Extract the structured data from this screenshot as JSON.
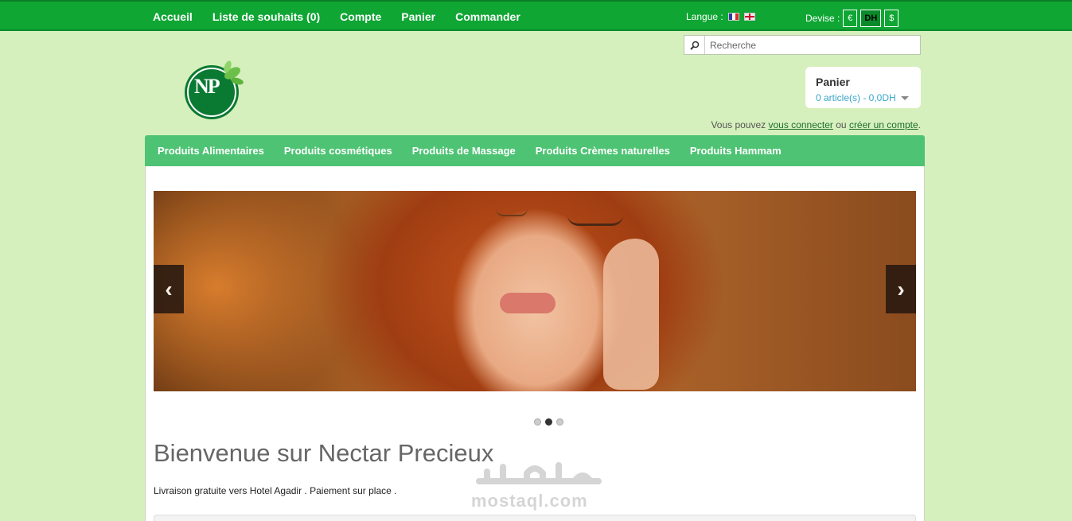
{
  "topbar": {
    "nav": [
      "Accueil",
      "Liste de souhaits (0)",
      "Compte",
      "Panier",
      "Commander"
    ],
    "language_label": "Langue :",
    "currency_label": "Devise :",
    "currencies": [
      "€",
      "DH",
      "$"
    ],
    "active_currency": "DH"
  },
  "search": {
    "placeholder": "Recherche"
  },
  "logo": {
    "text": "NP"
  },
  "cart": {
    "title": "Panier",
    "summary": "0 article(s) - 0,0DH"
  },
  "login": {
    "prefix": "Vous pouvez",
    "connect": "vous connecter",
    "or": "ou",
    "register": "créer un compte",
    "suffix": "."
  },
  "categories": [
    "Produits Alimentaires",
    "Produits cosmétiques",
    "Produits de Massage",
    "Produits Crèmes naturelles",
    "Produits Hammam"
  ],
  "slider": {
    "prev": "‹",
    "next": "›",
    "dots": 3,
    "active_dot": 1
  },
  "main": {
    "welcome": "Bienvenue sur Nectar Precieux",
    "description": "Livraison gratuite vers Hotel  Agadir . Paiement sur place ."
  },
  "watermark": {
    "latin": "mostaql.com"
  },
  "colors": {
    "topbar": "#0fa634",
    "catnav": "#4fc374",
    "background": "#d6f0bd"
  }
}
